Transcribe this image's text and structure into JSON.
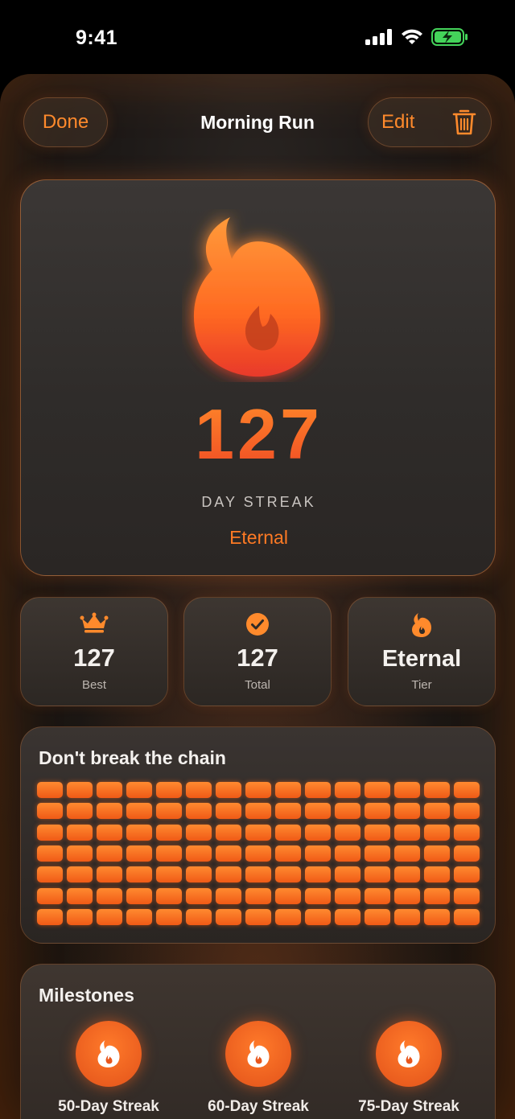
{
  "status": {
    "time": "9:41"
  },
  "nav": {
    "done_label": "Done",
    "title": "Morning Run",
    "edit_label": "Edit"
  },
  "hero": {
    "streak": "127",
    "label": "DAY STREAK",
    "tier": "Eternal"
  },
  "stats": [
    {
      "icon": "crown-icon",
      "value": "127",
      "label": "Best"
    },
    {
      "icon": "checkmark-circle-icon",
      "value": "127",
      "label": "Total"
    },
    {
      "icon": "flame-icon",
      "value": "Eternal",
      "label": "Tier"
    }
  ],
  "chain": {
    "title": "Don't break the chain",
    "columns": 15,
    "rows": 7,
    "completed_days": 127
  },
  "milestones": {
    "title": "Milestones",
    "items": [
      {
        "icon": "flame-icon",
        "label": "50-Day Streak"
      },
      {
        "icon": "flame-icon",
        "label": "60-Day Streak"
      },
      {
        "icon": "flame-icon",
        "label": "75-Day Streak"
      }
    ]
  },
  "colors": {
    "accent": "#ff7a24",
    "flame_top": "#ff8a2a",
    "flame_bottom": "#ef4a24",
    "background": "#000000"
  }
}
